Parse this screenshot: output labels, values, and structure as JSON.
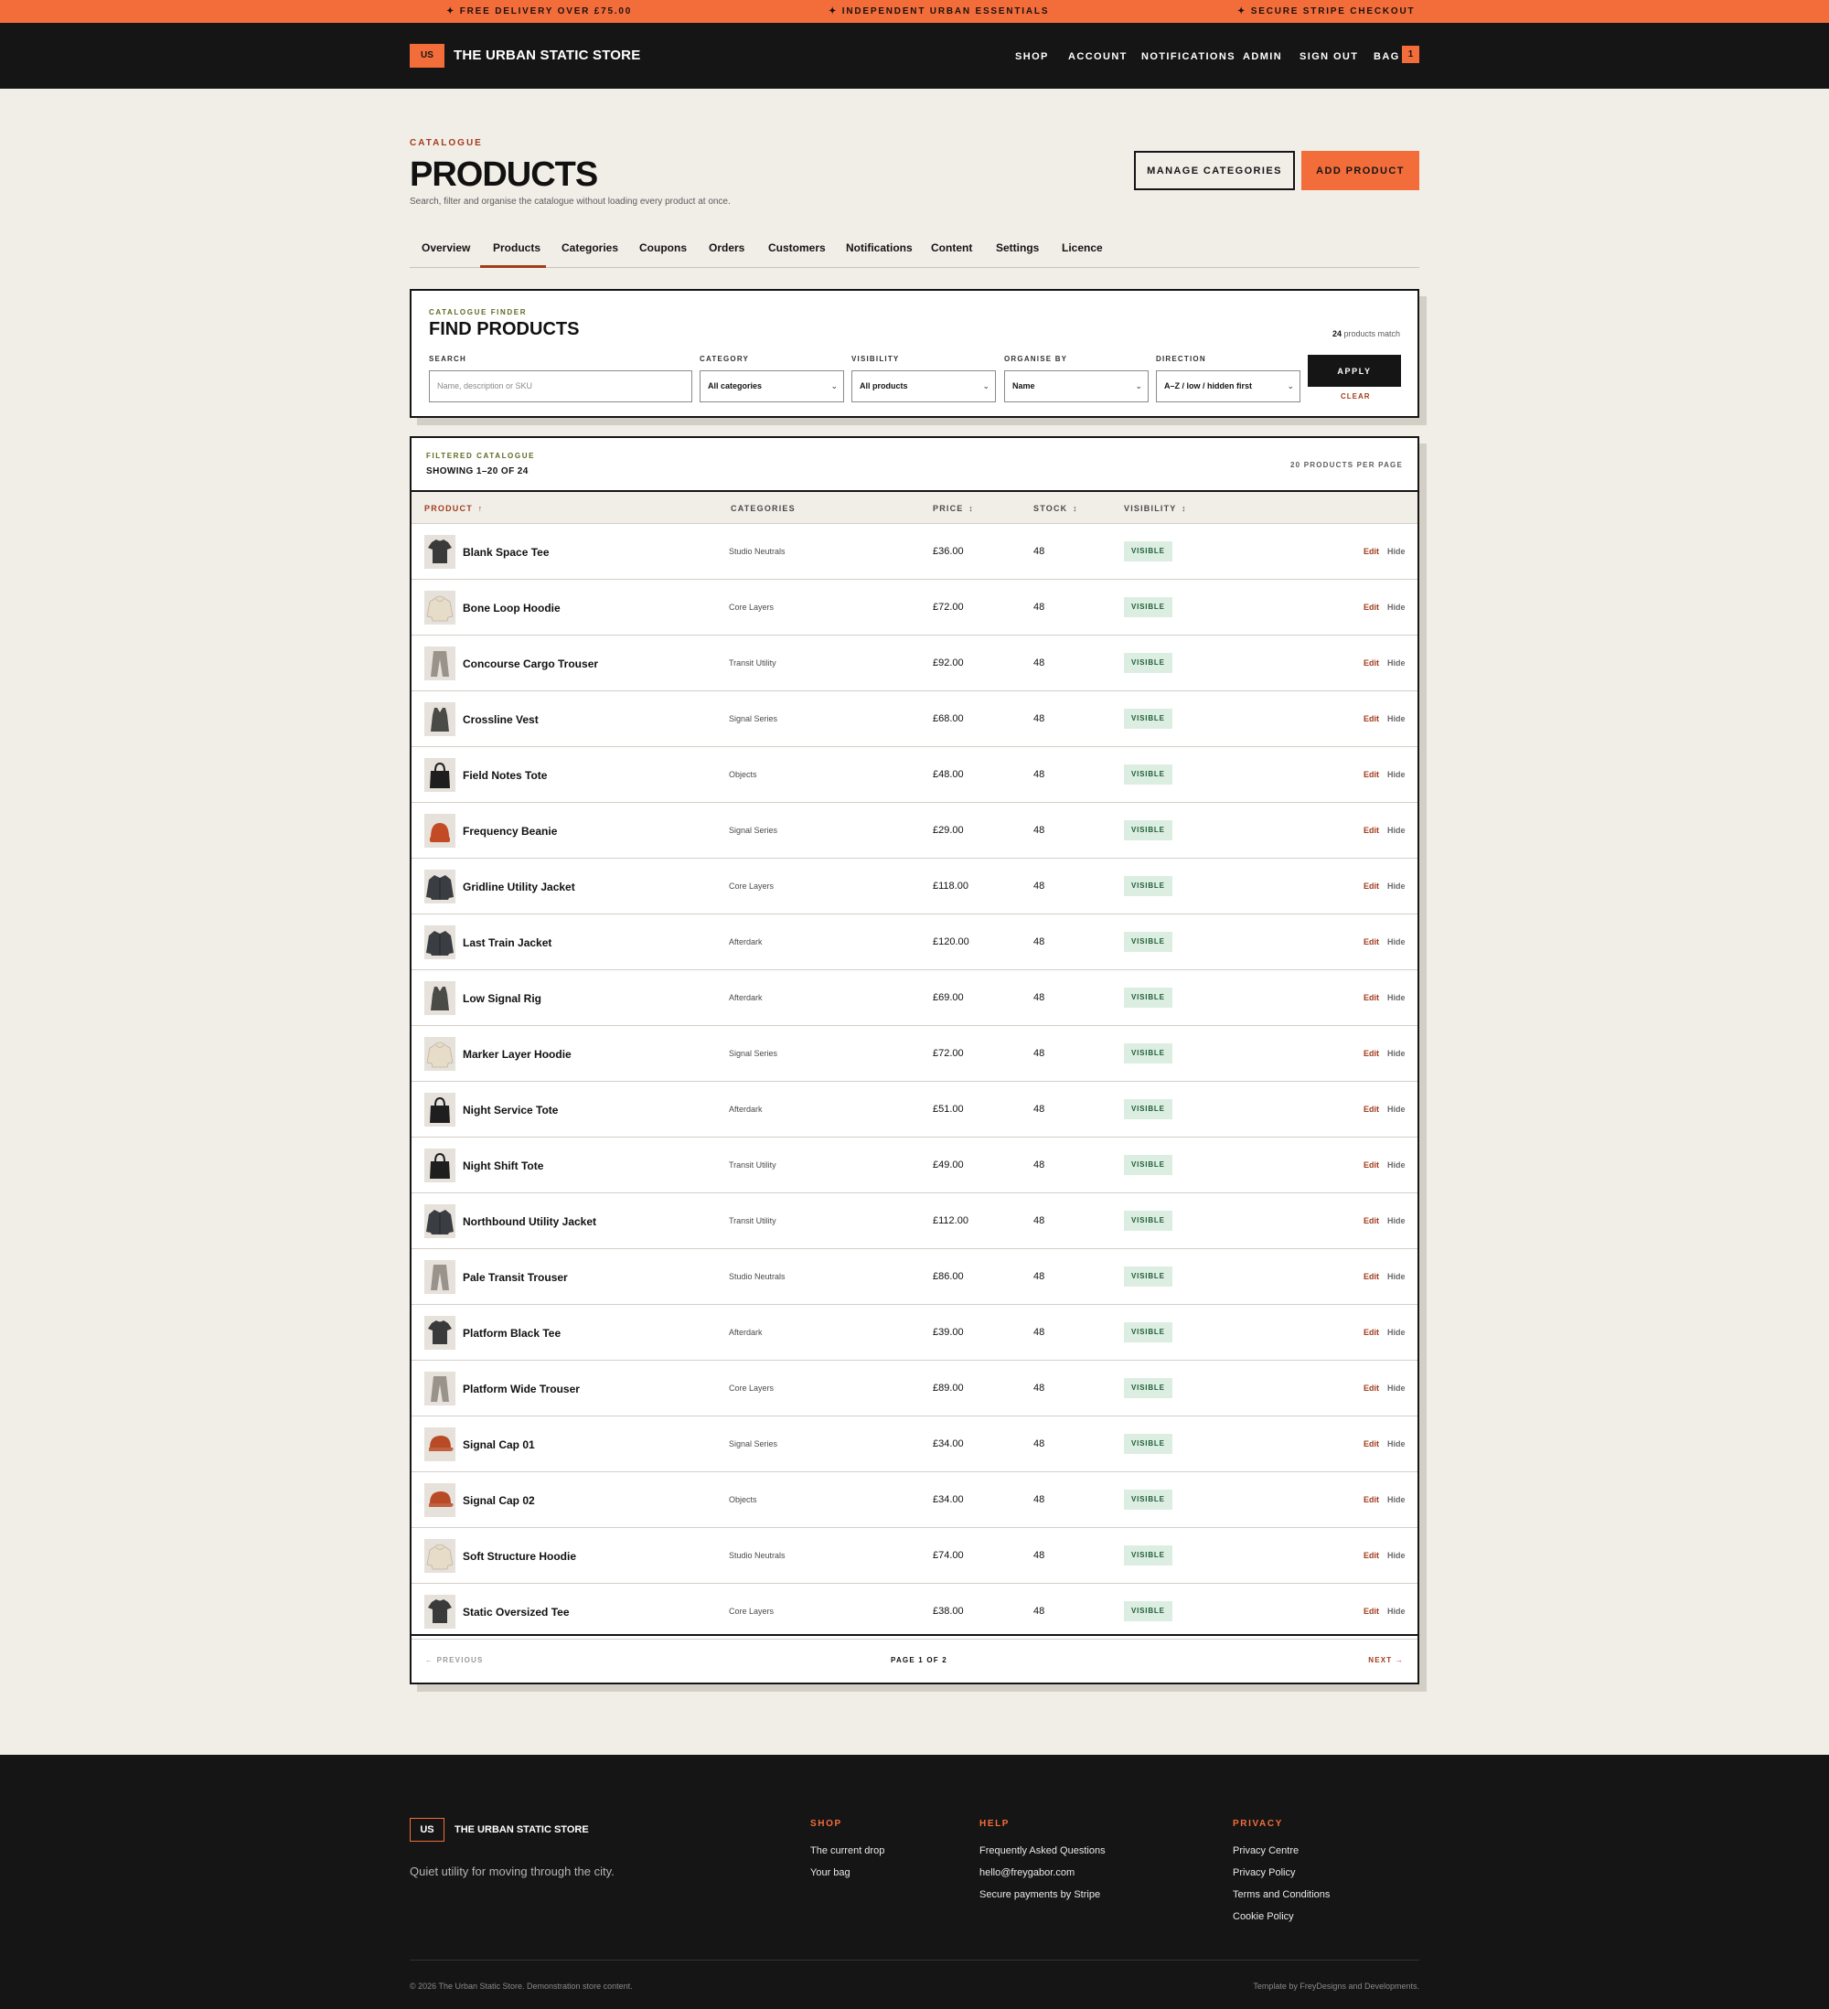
{
  "announcement": {
    "items": [
      "✦  FREE DELIVERY OVER £75.00",
      "✦  INDEPENDENT URBAN ESSENTIALS",
      "✦  SECURE STRIPE CHECKOUT"
    ]
  },
  "header": {
    "logo": "US",
    "brand": "THE URBAN STATIC STORE",
    "nav": [
      "SHOP",
      "ACCOUNT",
      "NOTIFICATIONS",
      "ADMIN",
      "SIGN OUT",
      "BAG"
    ],
    "bag_count": "1"
  },
  "page": {
    "eyebrow": "CATALOGUE",
    "title": "PRODUCTS",
    "subtitle": "Search, filter and organise the catalogue without loading every product at once.",
    "manage_categories": "MANAGE CATEGORIES",
    "add_product": "ADD PRODUCT"
  },
  "tabs": [
    "Overview",
    "Products",
    "Categories",
    "Coupons",
    "Orders",
    "Customers",
    "Notifications",
    "Content",
    "Settings",
    "Licence"
  ],
  "active_tab": "Products",
  "finder": {
    "eyebrow": "CATALOGUE FINDER",
    "title": "FIND PRODUCTS",
    "match_count": "24",
    "match_text": "products match",
    "search_label": "SEARCH",
    "search_placeholder": "Name, description or SKU",
    "category_label": "CATEGORY",
    "category_value": "All categories",
    "visibility_label": "VISIBILITY",
    "visibility_value": "All products",
    "organise_label": "ORGANISE BY",
    "organise_value": "Name",
    "direction_label": "DIRECTION",
    "direction_value": "A–Z / low / hidden first",
    "apply": "APPLY",
    "clear": "CLEAR"
  },
  "results": {
    "eyebrow": "FILTERED CATALOGUE",
    "showing": "SHOWING 1–20 OF 24",
    "per_page": "20 PRODUCTS PER PAGE",
    "columns": {
      "product": "PRODUCT",
      "product_sort": "↑",
      "categories": "CATEGORIES",
      "price": "PRICE",
      "price_sort": "↕",
      "stock": "STOCK",
      "stock_sort": "↕",
      "visibility": "VISIBILITY",
      "visibility_sort": "↕"
    },
    "edit_label": "Edit",
    "hide_label": "Hide",
    "rows": [
      {
        "name": "Blank Space Tee",
        "category": "Studio Neutrals",
        "price": "£36.00",
        "stock": "48",
        "visibility": "VISIBLE",
        "icon": "tee-icon",
        "color": "#3a3a3a"
      },
      {
        "name": "Bone Loop Hoodie",
        "category": "Core Layers",
        "price": "£72.00",
        "stock": "48",
        "visibility": "VISIBLE",
        "icon": "hoodie-icon",
        "color": "#e7dcc8"
      },
      {
        "name": "Concourse Cargo Trouser",
        "category": "Transit Utility",
        "price": "£92.00",
        "stock": "48",
        "visibility": "VISIBLE",
        "icon": "trouser-icon",
        "color": "#9a938b"
      },
      {
        "name": "Crossline Vest",
        "category": "Signal Series",
        "price": "£68.00",
        "stock": "48",
        "visibility": "VISIBLE",
        "icon": "vest-icon",
        "color": "#4a4a46"
      },
      {
        "name": "Field Notes Tote",
        "category": "Objects",
        "price": "£48.00",
        "stock": "48",
        "visibility": "VISIBLE",
        "icon": "tote-icon",
        "color": "#1e1e1e"
      },
      {
        "name": "Frequency Beanie",
        "category": "Signal Series",
        "price": "£29.00",
        "stock": "48",
        "visibility": "VISIBLE",
        "icon": "beanie-icon",
        "color": "#c24a24"
      },
      {
        "name": "Gridline Utility Jacket",
        "category": "Core Layers",
        "price": "£118.00",
        "stock": "48",
        "visibility": "VISIBLE",
        "icon": "jacket-icon",
        "color": "#3a3d42"
      },
      {
        "name": "Last Train Jacket",
        "category": "Afterdark",
        "price": "£120.00",
        "stock": "48",
        "visibility": "VISIBLE",
        "icon": "jacket-icon",
        "color": "#3a3d42"
      },
      {
        "name": "Low Signal Rig",
        "category": "Afterdark",
        "price": "£69.00",
        "stock": "48",
        "visibility": "VISIBLE",
        "icon": "vest-icon",
        "color": "#4a4a46"
      },
      {
        "name": "Marker Layer Hoodie",
        "category": "Signal Series",
        "price": "£72.00",
        "stock": "48",
        "visibility": "VISIBLE",
        "icon": "hoodie-icon",
        "color": "#e7dcc8"
      },
      {
        "name": "Night Service Tote",
        "category": "Afterdark",
        "price": "£51.00",
        "stock": "48",
        "visibility": "VISIBLE",
        "icon": "tote-icon",
        "color": "#1e1e1e"
      },
      {
        "name": "Night Shift Tote",
        "category": "Transit Utility",
        "price": "£49.00",
        "stock": "48",
        "visibility": "VISIBLE",
        "icon": "tote-icon",
        "color": "#1e1e1e"
      },
      {
        "name": "Northbound Utility Jacket",
        "category": "Transit Utility",
        "price": "£112.00",
        "stock": "48",
        "visibility": "VISIBLE",
        "icon": "jacket-icon",
        "color": "#3a3d42"
      },
      {
        "name": "Pale Transit Trouser",
        "category": "Studio Neutrals",
        "price": "£86.00",
        "stock": "48",
        "visibility": "VISIBLE",
        "icon": "trouser-icon",
        "color": "#9a938b"
      },
      {
        "name": "Platform Black Tee",
        "category": "Afterdark",
        "price": "£39.00",
        "stock": "48",
        "visibility": "VISIBLE",
        "icon": "tee-icon",
        "color": "#3a3a3a"
      },
      {
        "name": "Platform Wide Trouser",
        "category": "Core Layers",
        "price": "£89.00",
        "stock": "48",
        "visibility": "VISIBLE",
        "icon": "trouser-icon",
        "color": "#9a938b"
      },
      {
        "name": "Signal Cap 01",
        "category": "Signal Series",
        "price": "£34.00",
        "stock": "48",
        "visibility": "VISIBLE",
        "icon": "cap-icon",
        "color": "#b84a26"
      },
      {
        "name": "Signal Cap 02",
        "category": "Objects",
        "price": "£34.00",
        "stock": "48",
        "visibility": "VISIBLE",
        "icon": "cap-icon",
        "color": "#b84a26"
      },
      {
        "name": "Soft Structure Hoodie",
        "category": "Studio Neutrals",
        "price": "£74.00",
        "stock": "48",
        "visibility": "VISIBLE",
        "icon": "hoodie-icon",
        "color": "#e7dcc8"
      },
      {
        "name": "Static Oversized Tee",
        "category": "Core Layers",
        "price": "£38.00",
        "stock": "48",
        "visibility": "VISIBLE",
        "icon": "tee-icon",
        "color": "#3a3a3a"
      }
    ],
    "previous": "← PREVIOUS",
    "page_info": "PAGE 1 OF 2",
    "next": "NEXT →"
  },
  "footer": {
    "logo": "US",
    "brand": "THE URBAN STATIC STORE",
    "tagline": "Quiet utility for moving through the city.",
    "shop_heading": "SHOP",
    "shop_links": [
      "The current drop",
      "Your bag"
    ],
    "help_heading": "HELP",
    "help_links": [
      "Frequently Asked Questions",
      "hello@freygabor.com",
      "Secure payments by Stripe"
    ],
    "privacy_heading": "PRIVACY",
    "privacy_links": [
      "Privacy Centre",
      "Privacy Policy",
      "Terms and Conditions",
      "Cookie Policy"
    ],
    "copyright": "© 2026 The Urban Static Store. Demonstration store content.",
    "credit": "Template by FreyDesigns and Developments."
  },
  "colors": {
    "accent": "#f36d3b",
    "dark": "#151515",
    "background": "#f1eee8",
    "link": "#a23c1c",
    "visible_badge": "#dceee2"
  }
}
